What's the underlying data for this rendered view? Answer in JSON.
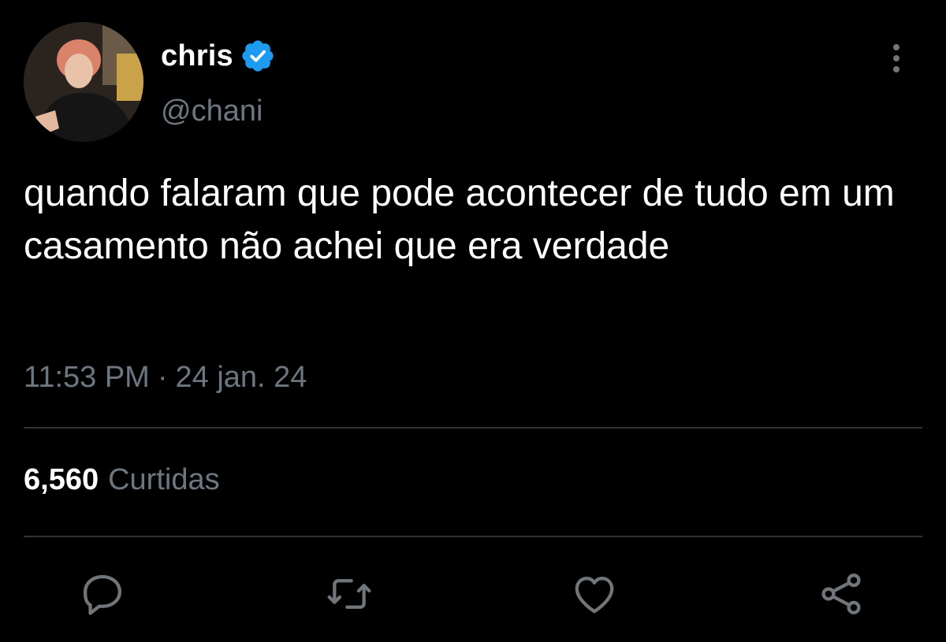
{
  "author": {
    "display_name": "chris",
    "handle": "@chani",
    "verified": true,
    "avatar_icon": "profile-photo"
  },
  "tweet": {
    "text": "quando falaram que pode acontecer de tudo em um casamento não achei que era verdade",
    "time": "11:53 PM",
    "separator": "·",
    "date": "24 jan. 24"
  },
  "stats": {
    "likes_count": "6,560",
    "likes_label": "Curtidas"
  },
  "actions": [
    {
      "icon": "reply-icon"
    },
    {
      "icon": "retweet-icon"
    },
    {
      "icon": "like-icon"
    },
    {
      "icon": "share-icon"
    }
  ],
  "colors": {
    "background": "#000000",
    "text": "#ffffff",
    "muted": "#6e7781",
    "divider": "#2f3336",
    "verified": "#1d9bf0",
    "icon": "#71767b"
  }
}
